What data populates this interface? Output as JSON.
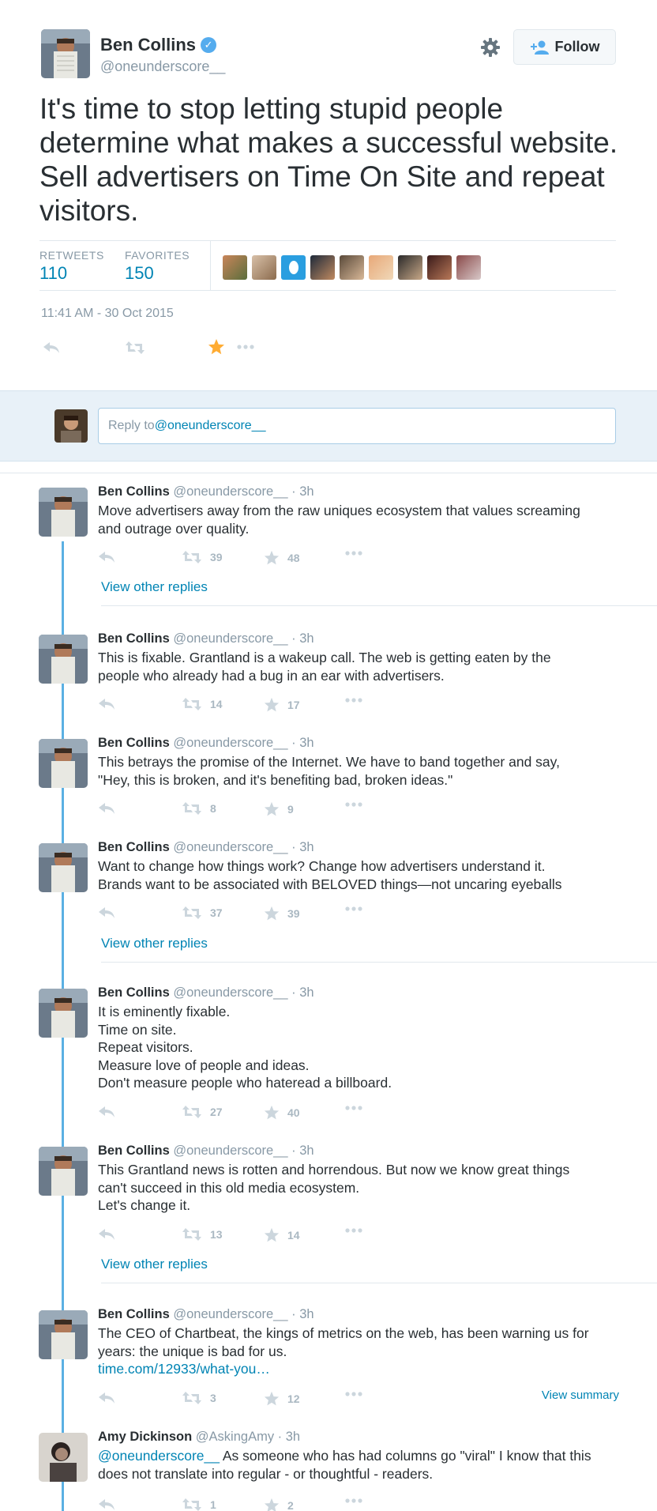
{
  "tweet": {
    "author_name": "Ben Collins",
    "author_handle": "@oneunderscore__",
    "follow_label": "Follow",
    "text": "It's time to stop letting stupid people determine what makes a successful website. Sell advertisers on Time On Site and repeat visitors.",
    "retweets_label": "RETWEETS",
    "retweets_count": "110",
    "favorites_label": "FAVORITES",
    "favorites_count": "150",
    "timestamp": "11:41 AM - 30 Oct 2015"
  },
  "reply_box": {
    "placeholder_prefix": "Reply to ",
    "mention": "@oneunderscore__"
  },
  "replies": [
    {
      "name": "Ben Collins",
      "handle": "@oneunderscore__",
      "time": "· 3h",
      "lines": [
        "Move advertisers away from the raw uniques ecosystem that values screaming",
        "and outrage over quality."
      ],
      "retweets": "39",
      "favorites": "48",
      "view_other_replies": "View other replies"
    },
    {
      "name": "Ben Collins",
      "handle": "@oneunderscore__",
      "time": "· 3h",
      "lines": [
        "This is fixable. Grantland is a wakeup call. The web is getting eaten by the",
        "people who already had a bug in an ear with advertisers."
      ],
      "retweets": "14",
      "favorites": "17"
    },
    {
      "name": "Ben Collins",
      "handle": "@oneunderscore__",
      "time": "· 3h",
      "lines": [
        "This betrays the promise of the Internet. We have to band together and say,",
        "\"Hey, this is broken, and it's benefiting bad, broken ideas.\""
      ],
      "retweets": "8",
      "favorites": "9"
    },
    {
      "name": "Ben Collins",
      "handle": "@oneunderscore__",
      "time": "· 3h",
      "lines": [
        "Want to change how things work? Change how advertisers understand it.",
        "Brands want to be associated with BELOVED things—not uncaring eyeballs"
      ],
      "retweets": "37",
      "favorites": "39",
      "view_other_replies": "View other replies"
    },
    {
      "name": "Ben Collins",
      "handle": "@oneunderscore__",
      "time": "· 3h",
      "lines": [
        "It is eminently fixable.",
        "Time on site.",
        "Repeat visitors.",
        "Measure love of people and ideas.",
        "Don't measure people who hateread a billboard."
      ],
      "retweets": "27",
      "favorites": "40"
    },
    {
      "name": "Ben Collins",
      "handle": "@oneunderscore__",
      "time": "· 3h",
      "lines": [
        "This Grantland news is rotten and horrendous. But now we know great things",
        "can't succeed in this old media ecosystem.",
        "Let's change it."
      ],
      "retweets": "13",
      "favorites": "14",
      "view_other_replies": "View other replies"
    },
    {
      "name": "Ben Collins",
      "handle": "@oneunderscore__",
      "time": "· 3h",
      "lines": [
        "The CEO of Chartbeat, the kings of metrics on the web, has been warning us for",
        "years: the unique is bad for us."
      ],
      "link": "time.com/12933/what-you…",
      "retweets": "3",
      "favorites": "12",
      "view_summary": "View summary"
    },
    {
      "name": "Amy Dickinson",
      "handle": "@AskingAmy",
      "time": "· 3h",
      "mention": "@oneunderscore__",
      "lines": [
        " As someone who has had columns go \"viral\" I know that this",
        "does not translate into regular - or thoughtful - readers."
      ],
      "retweets": "1",
      "favorites": "2"
    }
  ],
  "colors": {
    "link": "#0084b4",
    "muted": "#8899a6",
    "icon": "#aab8c2",
    "thread_line": "#5bb0e3",
    "favorited_star": "#ffac33",
    "reply_bg": "#e8f1f8"
  }
}
